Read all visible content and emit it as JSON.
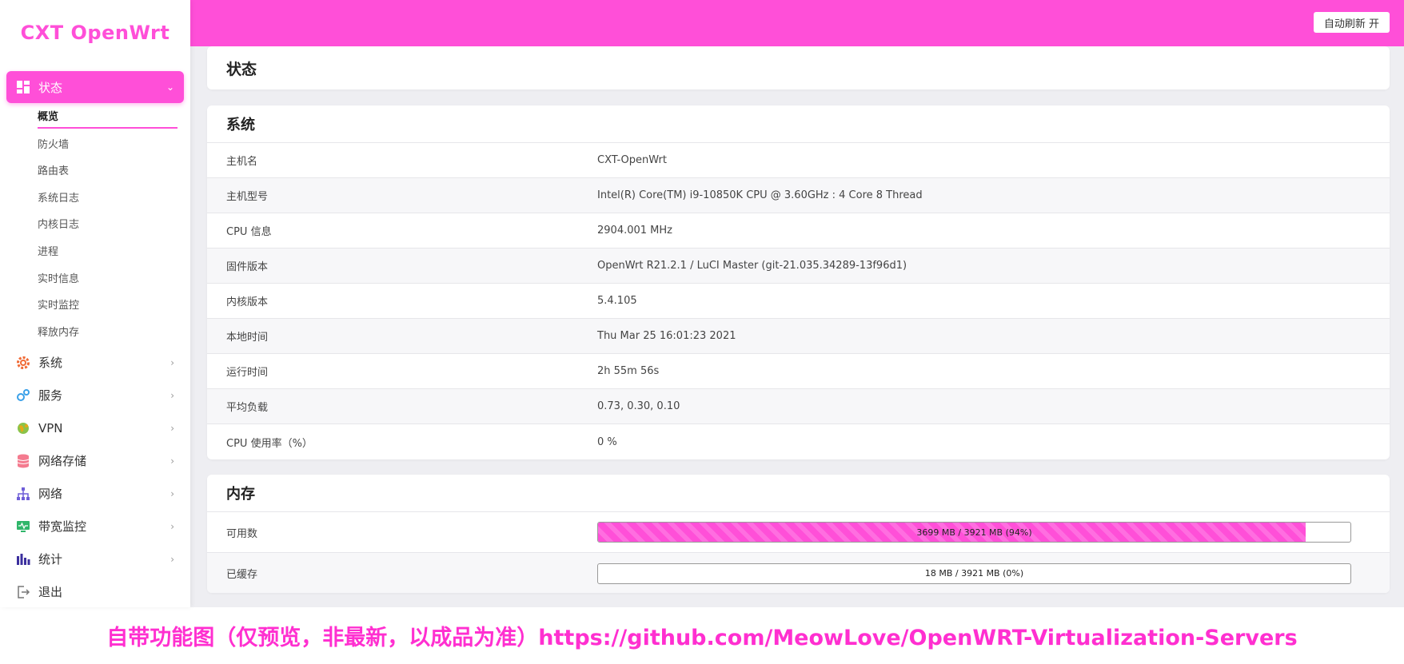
{
  "brand": "CXT OpenWrt",
  "header": {
    "refresh_label": "自动刷新 开"
  },
  "accent_color": "#ff4fd8",
  "sidebar": {
    "active_group": {
      "label": "状态",
      "icon": "dashboard-icon"
    },
    "submenu": [
      "概览",
      "防火墙",
      "路由表",
      "系统日志",
      "内核日志",
      "进程",
      "实时信息",
      "实时监控",
      "释放内存"
    ],
    "items": [
      {
        "label": "系统",
        "icon": "gear-icon"
      },
      {
        "label": "服务",
        "icon": "gears-icon"
      },
      {
        "label": "VPN",
        "icon": "globe-icon"
      },
      {
        "label": "网络存储",
        "icon": "database-icon"
      },
      {
        "label": "网络",
        "icon": "network-icon"
      },
      {
        "label": "带宽监控",
        "icon": "monitor-icon"
      },
      {
        "label": "统计",
        "icon": "bar-chart-icon"
      },
      {
        "label": "退出",
        "icon": "logout-icon"
      }
    ]
  },
  "page_title": "状态",
  "system": {
    "title": "系统",
    "rows": [
      {
        "key": "主机名",
        "value": "CXT-OpenWrt"
      },
      {
        "key": "主机型号",
        "value": "Intel(R) Core(TM) i9-10850K CPU @ 3.60GHz : 4 Core 8 Thread"
      },
      {
        "key": "CPU 信息",
        "value": "2904.001 MHz"
      },
      {
        "key": "固件版本",
        "value": "OpenWrt R21.2.1 / LuCI Master (git-21.035.34289-13f96d1)"
      },
      {
        "key": "内核版本",
        "value": "5.4.105"
      },
      {
        "key": "本地时间",
        "value": "Thu Mar 25 16:01:23 2021"
      },
      {
        "key": "运行时间",
        "value": "2h 55m 56s"
      },
      {
        "key": "平均负载",
        "value": "0.73, 0.30, 0.10"
      },
      {
        "key": "CPU 使用率（%）",
        "value": "0 %"
      }
    ]
  },
  "memory": {
    "title": "内存",
    "rows": [
      {
        "key": "可用数",
        "text": "3699 MB / 3921 MB (94%)",
        "percent": 94
      },
      {
        "key": "已缓存",
        "text": "18 MB / 3921 MB (0%)",
        "percent": 0
      }
    ]
  },
  "footer_banner": "自带功能图（仅预览，非最新，以成品为准）https://github.com/MeowLove/OpenWRT-Virtualization-Servers"
}
